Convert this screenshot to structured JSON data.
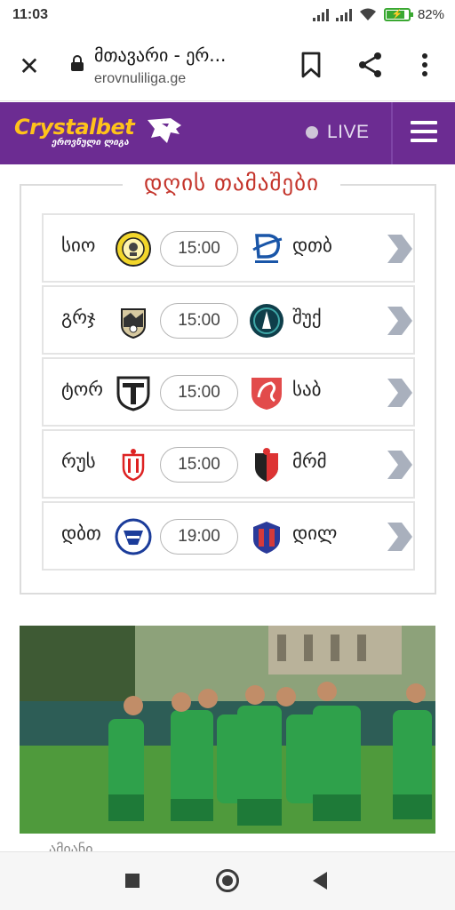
{
  "status_bar": {
    "time": "11:03",
    "battery": "82%",
    "battery_level": 0.82
  },
  "browser": {
    "title": "მთავარი - ერ...",
    "url": "erovnuliliga.ge"
  },
  "header": {
    "brand": "Crystalbet",
    "brand_sub": "ეროვნული ლიგა",
    "live_label": "LIVE",
    "colors": {
      "background": "#6c2c92",
      "brand": "#ffc21a"
    }
  },
  "section": {
    "title": "დღის თამაშები",
    "matches": [
      {
        "home": "სიო",
        "home_logo": "sioni-crest-icon",
        "time": "15:00",
        "away": "დთბ",
        "away_logo": "dinamo-tbilisi-crest-icon"
      },
      {
        "home": "გრჯ",
        "home_logo": "gareji-crest-icon",
        "time": "15:00",
        "away": "შუქ",
        "away_logo": "shukura-crest-icon"
      },
      {
        "home": "ტორ",
        "home_logo": "torpedo-crest-icon",
        "time": "15:00",
        "away": "საბ",
        "away_logo": "saburtalo-crest-icon"
      },
      {
        "home": "რუს",
        "home_logo": "rustavi-crest-icon",
        "time": "15:00",
        "away": "მრმ",
        "away_logo": "merani-crest-icon"
      },
      {
        "home": "დბთ",
        "home_logo": "dinamo-batumi-crest-icon",
        "time": "19:00",
        "away": "დილ",
        "away_logo": "dila-crest-icon"
      }
    ]
  },
  "news": {
    "image": "team-celebration-photo",
    "next_title_fragment": "ამიანი"
  }
}
